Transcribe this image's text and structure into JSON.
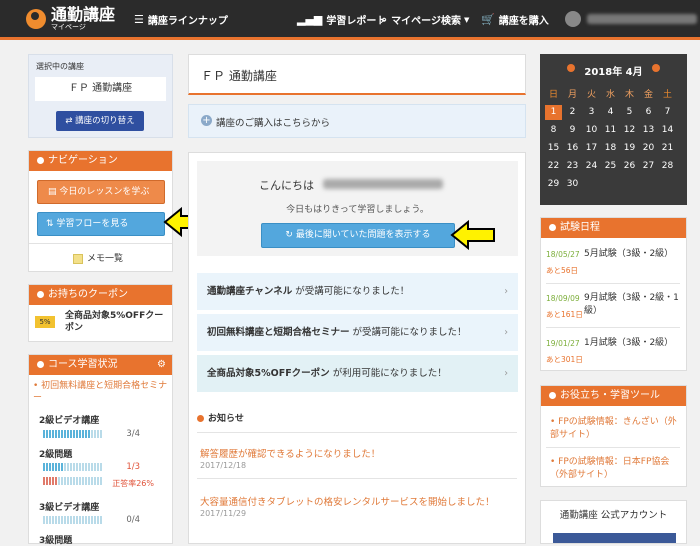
{
  "header": {
    "logo_main": "通勤講座",
    "logo_sub": "マイページ",
    "lineup": "講座ラインナップ",
    "report": "学習レポート",
    "search": "マイページ検索",
    "purchase": "講座を購入"
  },
  "left": {
    "selected_label": "選択中の講座",
    "selected_course": "ＦＰ 通勤講座",
    "switch_button": "講座の切り替え",
    "nav_title": "ナビゲーション",
    "today_lesson": "今日のレッスンを学ぶ",
    "study_flow": "学習フローを見る",
    "memo": "メモ一覧",
    "coupon_title": "お持ちのクーポン",
    "coupon_text": "全商品対象5%OFFクーポン",
    "coupon_icon": "5%",
    "status_title": "コース学習状況",
    "status_course": "初回無料講座と短期合格セミナー",
    "items": [
      {
        "name": "2級ビデオ講座",
        "progress": "3/4"
      },
      {
        "name": "2級問題",
        "progress": "1/3",
        "rate": "正答率26%"
      },
      {
        "name": "3級ビデオ講座",
        "progress": "0/4"
      },
      {
        "name": "3級問題",
        "progress": ""
      }
    ]
  },
  "main": {
    "title": "ＦＰ 通勤講座",
    "purchase_link": "講座のご購入はこちらから",
    "greeting": "こんにちは",
    "motto": "今日もはりきって学習しましょう。",
    "last_button": "最後に開いていた問題を表示する",
    "notices": [
      {
        "bold": "通勤講座チャンネル",
        "rest": " が受講可能になりました！"
      },
      {
        "bold": "初回無料講座と短期合格セミナー",
        "rest": " が受講可能になりました！"
      },
      {
        "bold": "全商品対象5%OFFクーポン",
        "rest": " が利用可能になりました！"
      }
    ],
    "news_title": "お知らせ",
    "news": [
      {
        "title": "解答履歴が確認できるようになりました！",
        "date": "2017/12/18"
      },
      {
        "title": "大容量通信付きタブレットの格安レンタルサービスを開始しました！",
        "date": "2017/11/29"
      }
    ]
  },
  "calendar": {
    "title": "2018年 4月",
    "weekdays": [
      "日",
      "月",
      "火",
      "水",
      "木",
      "金",
      "土"
    ],
    "weeks": [
      [
        "1",
        "2",
        "3",
        "4",
        "5",
        "6",
        "7"
      ],
      [
        "8",
        "9",
        "10",
        "11",
        "12",
        "13",
        "14"
      ],
      [
        "15",
        "16",
        "17",
        "18",
        "19",
        "20",
        "21"
      ],
      [
        "22",
        "23",
        "24",
        "25",
        "26",
        "27",
        "28"
      ],
      [
        "29",
        "30",
        "",
        "",
        "",
        "",
        ""
      ]
    ]
  },
  "exam": {
    "title": "試験日程",
    "rows": [
      {
        "date": "18/05/27",
        "until": "あと56日",
        "name": "5月試験（3級・2級）"
      },
      {
        "date": "18/09/09",
        "until": "あと161日",
        "name": "9月試験（3級・2級・1級）"
      },
      {
        "date": "19/01/27",
        "until": "あと301日",
        "name": "1月試験（3級・2級）"
      }
    ]
  },
  "tools": {
    "title": "お役立ち・学習ツール",
    "items": [
      "FPの試験情報：きんざい（外部サイト）",
      "FPの試験情報：日本FP協会（外部サイト）"
    ]
  },
  "official": {
    "title": "通勤講座 公式アカウント"
  },
  "colors": {
    "accent": "#e8732e",
    "blue": "#53a7dd",
    "notice_bg": "#eaf4fb",
    "calendar_bg": "#3a3a3a",
    "arrow": "#fff200"
  }
}
